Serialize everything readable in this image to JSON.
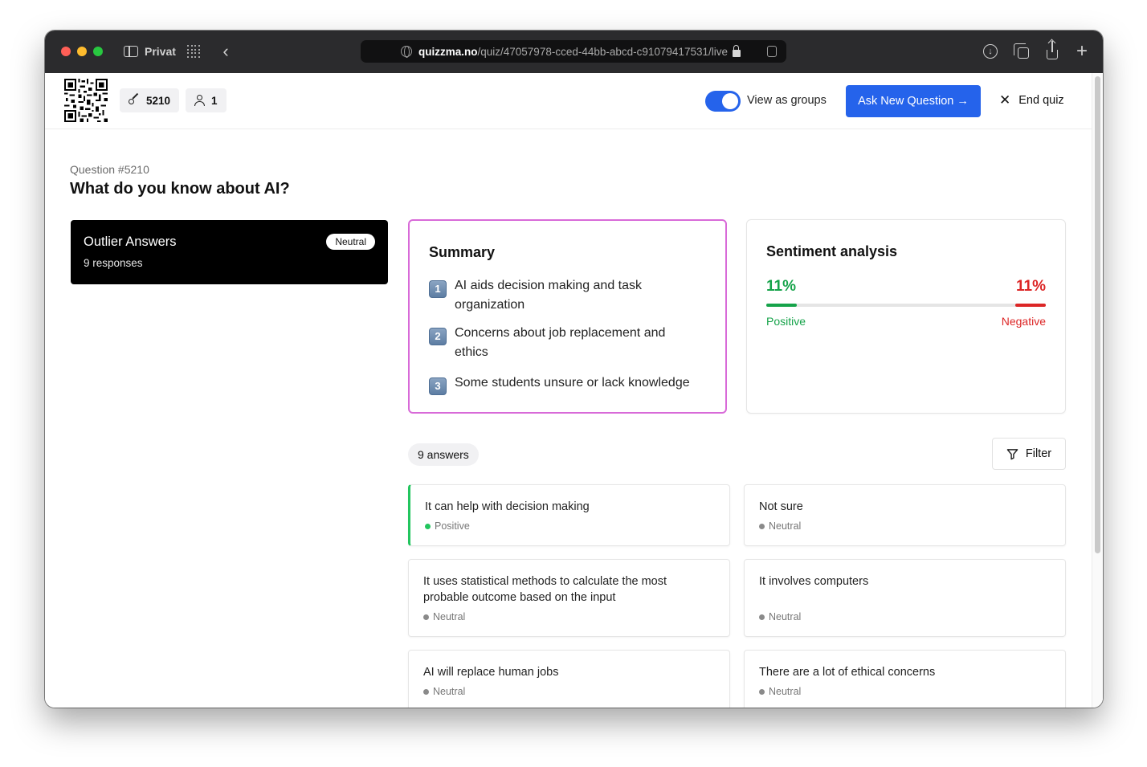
{
  "browser": {
    "profile_label": "Privat",
    "url_host": "quizzma.no",
    "url_path": "/quiz/47057978-cced-44bb-abcd-c91079417531/live"
  },
  "header": {
    "quiz_code": "5210",
    "participants": "1",
    "toggle_label": "View as groups",
    "toggle_on": true,
    "ask_button": "Ask New Question →",
    "end_button": "End quiz"
  },
  "question": {
    "number": "Question #5210",
    "title": "What do you know about AI?"
  },
  "outlier": {
    "title": "Outlier Answers",
    "responses": "9 responses",
    "badge": "Neutral"
  },
  "summary": {
    "title": "Summary",
    "items": [
      {
        "num": "1",
        "text": "AI aids decision making and task organization"
      },
      {
        "num": "2",
        "text": "Concerns about job replacement and ethics"
      },
      {
        "num": "3",
        "text": "Some students unsure or lack knowledge"
      }
    ]
  },
  "sentiment": {
    "title": "Sentiment analysis",
    "positive_value": "11%",
    "negative_value": "11%",
    "positive_fraction": 0.11,
    "negative_fraction": 0.11,
    "positive_label": "Positive",
    "negative_label": "Negative",
    "colors": {
      "positive": "#16a34a",
      "negative": "#dc2626"
    }
  },
  "answers": {
    "count_label": "9 answers",
    "filter_label": "Filter",
    "items": [
      {
        "text": "It can help with decision making",
        "sentiment": "Positive"
      },
      {
        "text": "Not sure",
        "sentiment": "Neutral"
      },
      {
        "text": "It uses statistical methods to calculate the most probable outcome based on the input",
        "sentiment": "Neutral"
      },
      {
        "text": "It involves computers",
        "sentiment": "Neutral"
      },
      {
        "text": "AI will replace human jobs",
        "sentiment": "Neutral"
      },
      {
        "text": "There are a lot of ethical concerns",
        "sentiment": "Neutral"
      }
    ]
  },
  "colors": {
    "accent": "#2563eb",
    "summary_border": "#d86ad8"
  }
}
